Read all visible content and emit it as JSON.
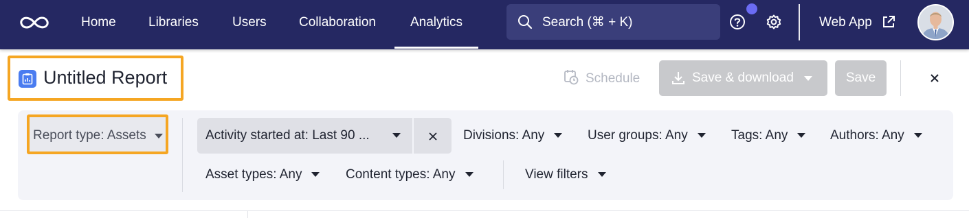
{
  "nav": {
    "items": [
      {
        "label": "Home"
      },
      {
        "label": "Libraries"
      },
      {
        "label": "Users"
      },
      {
        "label": "Collaboration"
      },
      {
        "label": "Analytics",
        "active": true
      }
    ],
    "search_label": "Search (⌘ + K)",
    "web_app_label": "Web App"
  },
  "report": {
    "title": "Untitled Report"
  },
  "actions": {
    "schedule_label": "Schedule",
    "save_download_label": "Save & download",
    "save_label": "Save"
  },
  "filters": {
    "report_type": "Report type: Assets",
    "activity": "Activity started at: Last 90 ...",
    "divisions": "Divisions: Any",
    "user_groups": "User groups: Any",
    "tags": "Tags: Any",
    "authors": "Authors: Any",
    "asset_types": "Asset types: Any",
    "content_types": "Content types: Any",
    "view_filters": "View filters"
  },
  "colors": {
    "nav_bg": "#252862",
    "highlight_border": "#f5a623",
    "report_icon": "#4a7cf0",
    "notification_dot": "#6b6cf4",
    "disabled_button": "#c8c9cc"
  }
}
